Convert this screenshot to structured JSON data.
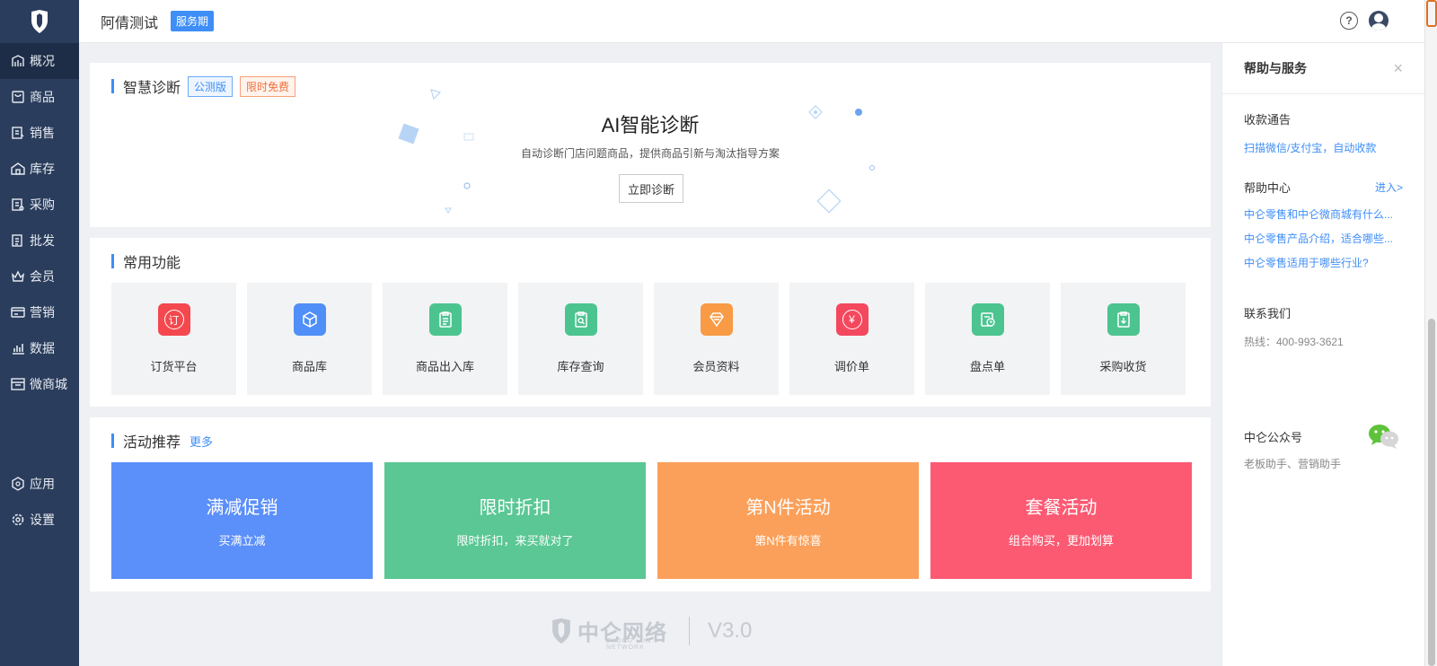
{
  "sidebar": {
    "items": [
      {
        "label": "概况",
        "icon": "dashboard-icon"
      },
      {
        "label": "商品",
        "icon": "product-icon"
      },
      {
        "label": "销售",
        "icon": "sales-icon"
      },
      {
        "label": "库存",
        "icon": "inventory-icon"
      },
      {
        "label": "采购",
        "icon": "purchase-icon"
      },
      {
        "label": "批发",
        "icon": "wholesale-icon"
      },
      {
        "label": "会员",
        "icon": "member-icon"
      },
      {
        "label": "营销",
        "icon": "marketing-icon"
      },
      {
        "label": "数据",
        "icon": "data-icon"
      },
      {
        "label": "微商城",
        "icon": "store-icon"
      }
    ],
    "bottom_items": [
      {
        "label": "应用",
        "icon": "apps-icon"
      },
      {
        "label": "设置",
        "icon": "settings-icon"
      }
    ]
  },
  "header": {
    "shop_name": "阿倩测试",
    "badge": "服务期",
    "help_icon": "?"
  },
  "diagnosis": {
    "title": "智慧诊断",
    "tag_beta": "公测版",
    "tag_free": "限时免费",
    "headline": "AI智能诊断",
    "subtitle": "自动诊断门店问题商品，提供商品引新与淘汰指导方案",
    "button": "立即诊断"
  },
  "common": {
    "title": "常用功能",
    "items": [
      {
        "label": "订货平台",
        "icon": "order-icon",
        "color": "#f4484e",
        "glyph": "订"
      },
      {
        "label": "商品库",
        "icon": "box-icon",
        "color": "#4f8ff7",
        "glyph": ""
      },
      {
        "label": "商品出入库",
        "icon": "clipboard-icon",
        "color": "#4cc490",
        "glyph": ""
      },
      {
        "label": "库存查询",
        "icon": "search-doc-icon",
        "color": "#4cc490",
        "glyph": ""
      },
      {
        "label": "会员资料",
        "icon": "diamond-icon",
        "color": "#f99a45",
        "glyph": ""
      },
      {
        "label": "调价单",
        "icon": "price-adjust-icon",
        "color": "#f4485e",
        "glyph": "¥"
      },
      {
        "label": "盘点单",
        "icon": "stocktake-icon",
        "color": "#4cc490",
        "glyph": ""
      },
      {
        "label": "采购收货",
        "icon": "receive-icon",
        "color": "#4cc490",
        "glyph": ""
      }
    ]
  },
  "activity": {
    "title": "活动推荐",
    "more": "更多",
    "items": [
      {
        "title": "满减促销",
        "subtitle": "买满立减",
        "color": "#5b8ff9"
      },
      {
        "title": "限时折扣",
        "subtitle": "限时折扣，来买就对了",
        "color": "#5ac794"
      },
      {
        "title": "第N件活动",
        "subtitle": "第N件有惊喜",
        "color": "#fba05a"
      },
      {
        "title": "套餐活动",
        "subtitle": "组合购买，更加划算",
        "color": "#fc5a73"
      }
    ]
  },
  "footer": {
    "brand": "中仑网络",
    "brand_en": "ZHONG LUN NETWORK",
    "version": "V3.0"
  },
  "right_panel": {
    "title": "帮助与服务",
    "close": "×",
    "payment": {
      "title": "收款通告",
      "link": "扫描微信/支付宝，自动收款"
    },
    "help_center": {
      "title": "帮助中心",
      "enter": "进入>",
      "links": [
        "中仑零售和中仑微商城有什么...",
        "中仑零售产品介绍，适合哪些...",
        "中仑零售适用于哪些行业?"
      ]
    },
    "contact": {
      "title": "联系我们",
      "hotline": "热线：400-993-3621"
    },
    "official": {
      "title": "中仑公众号",
      "subtitle": "老板助手、营销助手"
    }
  }
}
